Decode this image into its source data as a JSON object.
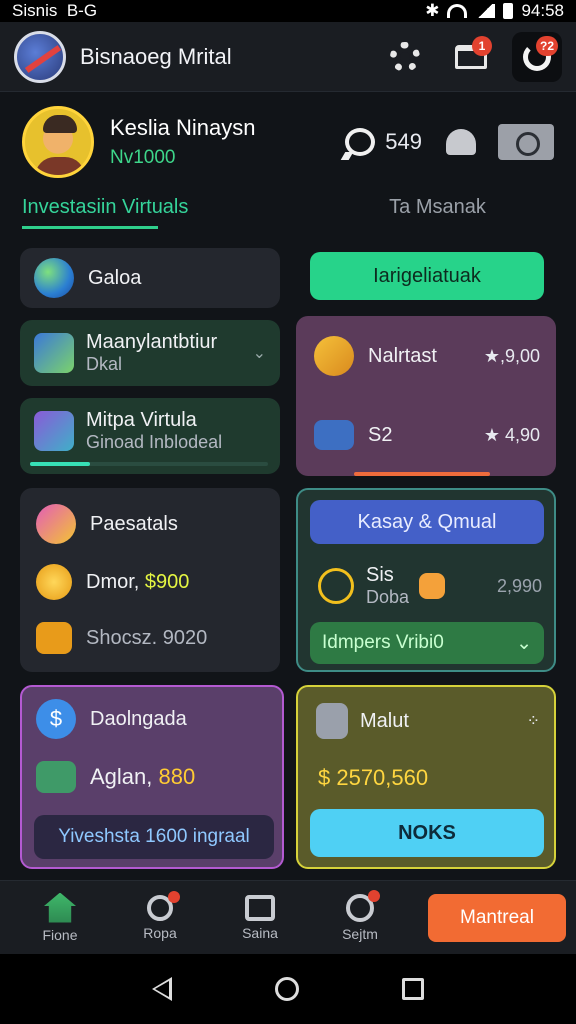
{
  "status": {
    "left": "Sisnis",
    "center": "B-G",
    "time": "94:58"
  },
  "header": {
    "title": "Bisnaoeg Mrital",
    "notif_badge": "1",
    "power_badge": "?2"
  },
  "profile": {
    "name": "Keslia Ninaysn",
    "id": "Nv1000",
    "messages": "549"
  },
  "tabs": [
    {
      "label": "Investasiin Virtuals"
    },
    {
      "label": "Ta Msanak"
    }
  ],
  "cards": {
    "globe": {
      "label": "Galoa"
    },
    "manage": {
      "label": "Maanylantbtiur",
      "sub": "Dkal"
    },
    "mitpa": {
      "label": "Mitpa Virtula",
      "sub": "Ginoad Inblodeal",
      "progress": 0.25
    },
    "green_button": "Iarigeliatuak",
    "market": {
      "label": "Nalrtast",
      "value": "★,9,00",
      "row2_label": "S2",
      "row2_value": "★ 4,90"
    },
    "paes": {
      "label": "Paesatals",
      "row1": "Dmor, ",
      "row1_value": "$900",
      "row2": "Shocsz. 9020"
    },
    "kasy": {
      "button": "Kasay & Qmual",
      "label": "Sis",
      "sub": "Doba",
      "value": "2,990",
      "dropdown": "Idmpers Vribi0"
    },
    "dadl": {
      "label": "Daolngada",
      "row": "Aglan, ",
      "row_value": "880",
      "pill": "Yiveshsta 1600 ingraal"
    },
    "malut": {
      "label": "Malut",
      "value": "$ 2570,560",
      "button": "NOKS"
    }
  },
  "bottom_nav": [
    {
      "label": "Fione"
    },
    {
      "label": "Ropa"
    },
    {
      "label": "Saina"
    },
    {
      "label": "Sejtm"
    }
  ],
  "bottom_action": "Mantreal",
  "colors": {
    "accent_green": "#27d38a",
    "tab_active": "#35d49a",
    "orange": "#f26b33",
    "cyan": "#4fd0f4"
  }
}
